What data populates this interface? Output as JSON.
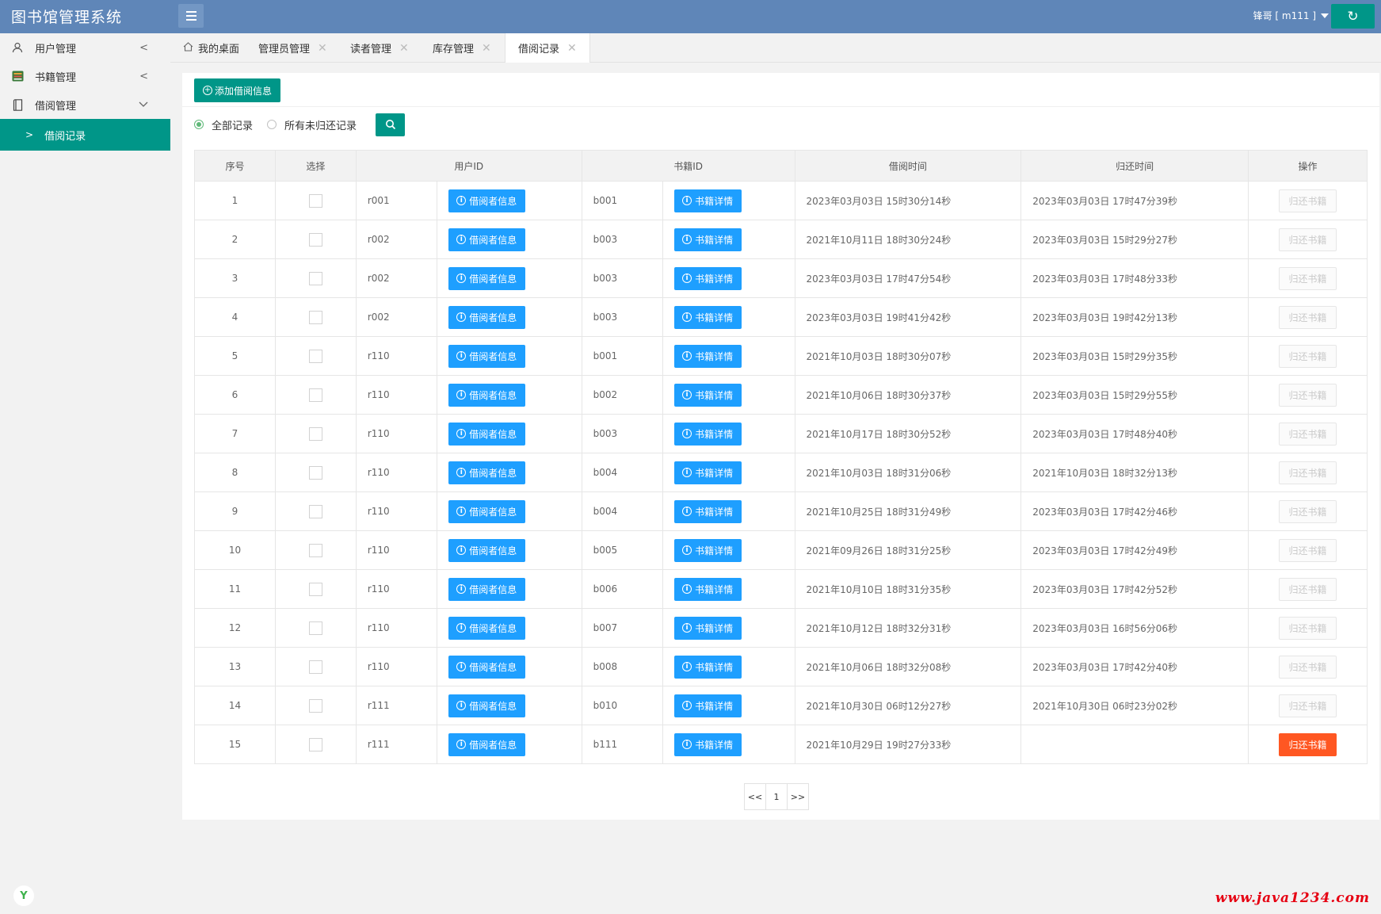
{
  "header": {
    "app_title": "图书馆管理系统",
    "user_label": "锋哥 [ m111 ]",
    "refresh_glyph": "↻"
  },
  "sidebar": {
    "items": [
      {
        "label": "用户管理",
        "icon": "user-icon"
      },
      {
        "label": "书籍管理",
        "icon": "book-icon"
      },
      {
        "label": "借阅管理",
        "icon": "notebook-icon"
      }
    ],
    "active_sub": {
      "label": "借阅记录"
    }
  },
  "tabs": [
    {
      "label": "我的桌面"
    },
    {
      "label": "管理员管理"
    },
    {
      "label": "读者管理"
    },
    {
      "label": "库存管理"
    },
    {
      "label": "借阅记录"
    }
  ],
  "toolbar": {
    "add_label": "添加借阅信息",
    "filter_all": "全部记录",
    "filter_unreturned": "所有未归还记录"
  },
  "table": {
    "headers": [
      "序号",
      "选择",
      "用户ID",
      "书籍ID",
      "借阅时间",
      "归还时间",
      "操作"
    ],
    "borrower_btn_label": "借阅者信息",
    "book_btn_label": "书籍详情",
    "return_btn_label": "归还书籍",
    "rows": [
      {
        "no": "1",
        "uid": "r001",
        "bid": "b001",
        "borrow": "2023年03月03日 15时30分14秒",
        "ret": "2023年03月03日 17时47分39秒"
      },
      {
        "no": "2",
        "uid": "r002",
        "bid": "b003",
        "borrow": "2021年10月11日 18时30分24秒",
        "ret": "2023年03月03日 15时29分27秒"
      },
      {
        "no": "3",
        "uid": "r002",
        "bid": "b003",
        "borrow": "2023年03月03日 17时47分54秒",
        "ret": "2023年03月03日 17时48分33秒"
      },
      {
        "no": "4",
        "uid": "r002",
        "bid": "b003",
        "borrow": "2023年03月03日 19时41分42秒",
        "ret": "2023年03月03日 19时42分13秒"
      },
      {
        "no": "5",
        "uid": "r110",
        "bid": "b001",
        "borrow": "2021年10月03日 18时30分07秒",
        "ret": "2023年03月03日 15时29分35秒"
      },
      {
        "no": "6",
        "uid": "r110",
        "bid": "b002",
        "borrow": "2021年10月06日 18时30分37秒",
        "ret": "2023年03月03日 15时29分55秒"
      },
      {
        "no": "7",
        "uid": "r110",
        "bid": "b003",
        "borrow": "2021年10月17日 18时30分52秒",
        "ret": "2023年03月03日 17时48分40秒"
      },
      {
        "no": "8",
        "uid": "r110",
        "bid": "b004",
        "borrow": "2021年10月03日 18时31分06秒",
        "ret": "2021年10月03日 18时32分13秒"
      },
      {
        "no": "9",
        "uid": "r110",
        "bid": "b004",
        "borrow": "2021年10月25日 18时31分49秒",
        "ret": "2023年03月03日 17时42分46秒"
      },
      {
        "no": "10",
        "uid": "r110",
        "bid": "b005",
        "borrow": "2021年09月26日 18时31分25秒",
        "ret": "2023年03月03日 17时42分49秒"
      },
      {
        "no": "11",
        "uid": "r110",
        "bid": "b006",
        "borrow": "2021年10月10日 18时31分35秒",
        "ret": "2023年03月03日 17时42分52秒"
      },
      {
        "no": "12",
        "uid": "r110",
        "bid": "b007",
        "borrow": "2021年10月12日 18时32分31秒",
        "ret": "2023年03月03日 16时56分06秒"
      },
      {
        "no": "13",
        "uid": "r110",
        "bid": "b008",
        "borrow": "2021年10月06日 18时32分08秒",
        "ret": "2023年03月03日 17时42分40秒"
      },
      {
        "no": "14",
        "uid": "r111",
        "bid": "b010",
        "borrow": "2021年10月30日 06时12分27秒",
        "ret": "2021年10月30日 06时23分02秒"
      },
      {
        "no": "15",
        "uid": "r111",
        "bid": "b111",
        "borrow": "2021年10月29日 19时27分33秒",
        "ret": ""
      }
    ]
  },
  "pagination": {
    "prev": "<<",
    "page": "1",
    "next": ">>"
  },
  "watermark": "www.java1234.com",
  "colors": {
    "primary": "#009688",
    "header": "#5f86b8",
    "info": "#1e9fff",
    "danger": "#ff5722"
  }
}
